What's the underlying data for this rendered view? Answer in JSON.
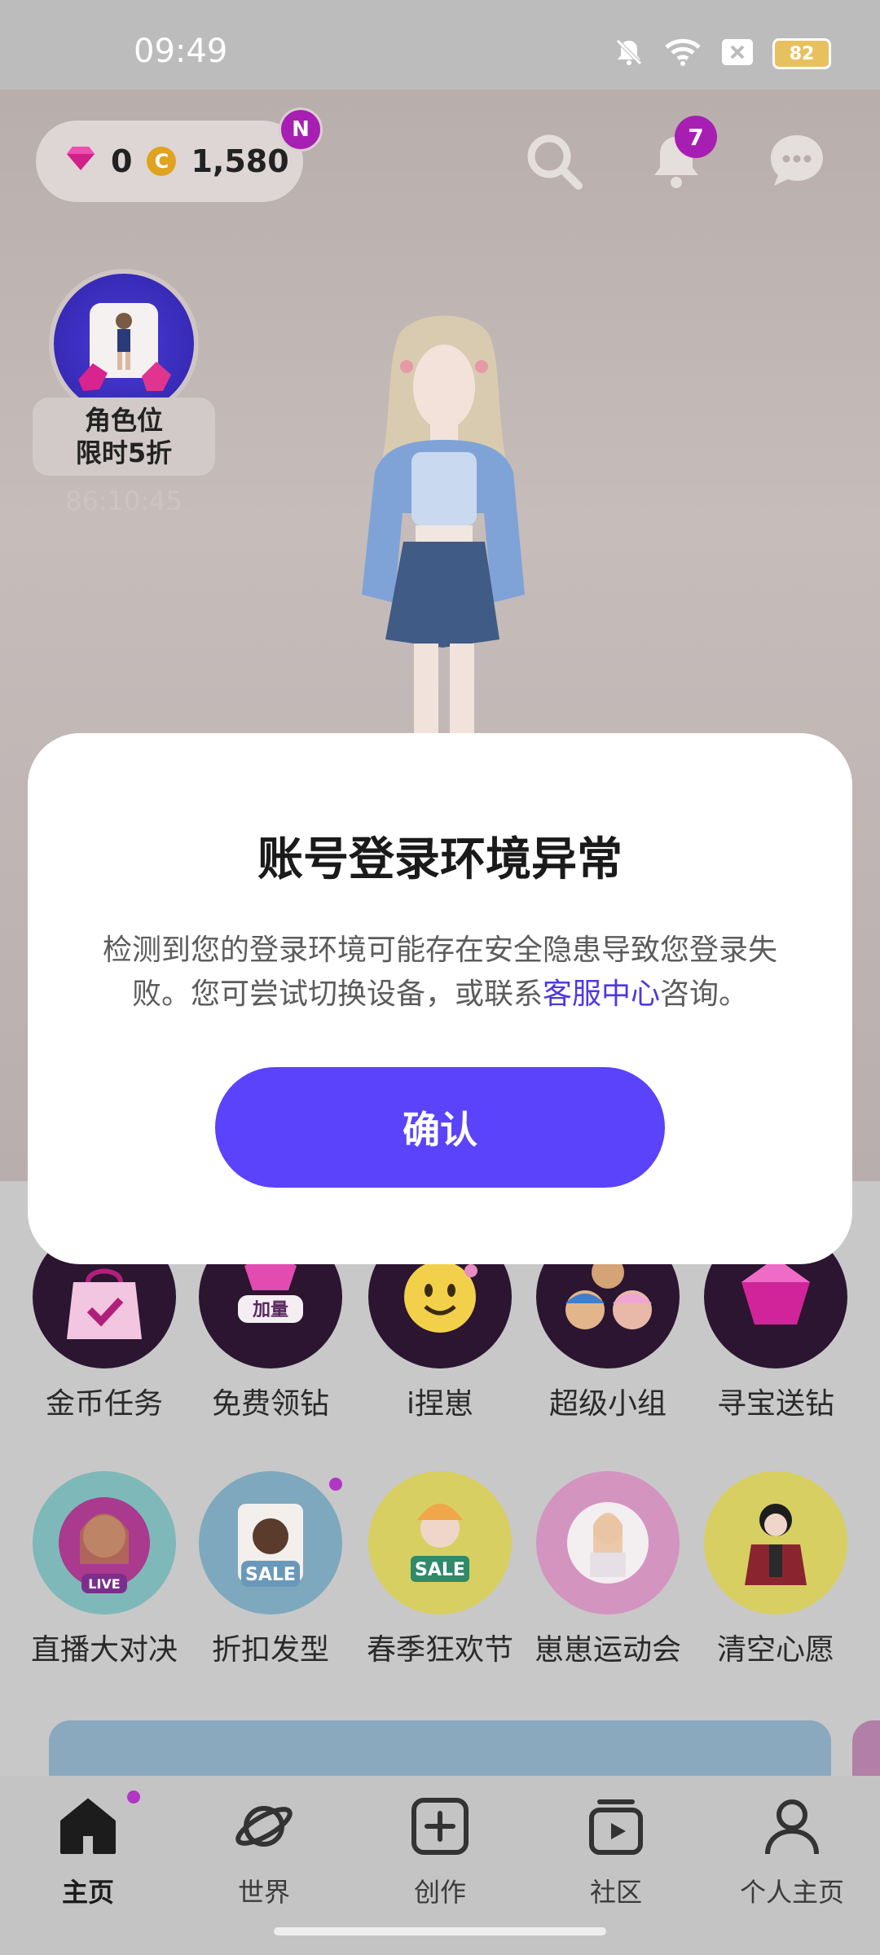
{
  "status_bar": {
    "time": "09:49",
    "battery": "82"
  },
  "header": {
    "gems": "0",
    "coin_symbol": "C",
    "coins": "1,580",
    "new_badge": "N",
    "notification_count": "7"
  },
  "promo": {
    "line1": "角色位",
    "line2": "限时5折",
    "timer": "86:10:45"
  },
  "grid_row1": [
    {
      "label": "金币任务"
    },
    {
      "label": "免费领钻",
      "sticker": "加量"
    },
    {
      "label": "i捏崽"
    },
    {
      "label": "超级小组"
    },
    {
      "label": "寻宝送钻"
    }
  ],
  "grid_row2": [
    {
      "label": "直播大对决",
      "sticker": "LIVE"
    },
    {
      "label": "折扣发型",
      "sticker": "SALE"
    },
    {
      "label": "春季狂欢节",
      "sticker": "SALE"
    },
    {
      "label": "崽崽运动会"
    },
    {
      "label": "清空心愿"
    }
  ],
  "dialog": {
    "title": "账号登录环境异常",
    "body_before": "检测到您的登录环境可能存在安全隐患导致您登录失败。您可尝试切换设备，或联系",
    "link": "客服中心",
    "body_after": "咨询。",
    "confirm": "确认"
  },
  "nav": [
    {
      "label": "主页",
      "icon": "home-icon"
    },
    {
      "label": "世界",
      "icon": "planet-icon"
    },
    {
      "label": "创作",
      "icon": "plus-square-icon"
    },
    {
      "label": "社区",
      "icon": "community-icon"
    },
    {
      "label": "个人主页",
      "icon": "profile-icon"
    }
  ],
  "colors": {
    "accent": "#5a43fb",
    "badge": "#a71fb2",
    "link": "#4e38e0"
  }
}
